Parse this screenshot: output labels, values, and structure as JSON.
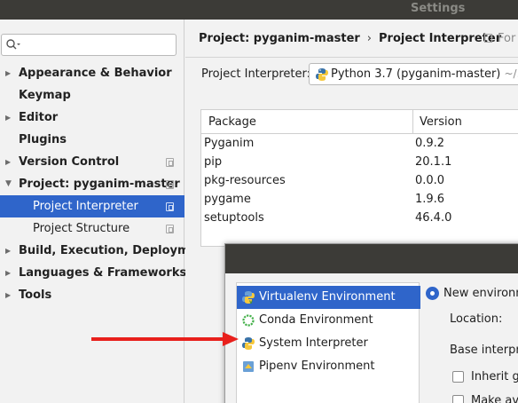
{
  "window": {
    "title": "Settings"
  },
  "search": {
    "placeholder": ""
  },
  "sidebar": {
    "items": [
      {
        "label": "Appearance & Behavior"
      },
      {
        "label": "Keymap"
      },
      {
        "label": "Editor"
      },
      {
        "label": "Plugins"
      },
      {
        "label": "Version Control"
      },
      {
        "label": "Project: pyganim-master"
      },
      {
        "label": "Project Interpreter"
      },
      {
        "label": "Project Structure"
      },
      {
        "label": "Build, Execution, Deployment"
      },
      {
        "label": "Languages & Frameworks"
      },
      {
        "label": "Tools"
      }
    ]
  },
  "breadcrumb": {
    "project": "Project: pyganim-master",
    "separator": "›",
    "page": "Project Interpreter",
    "for_current": "For c"
  },
  "interpreter": {
    "label": "Project Interpreter:",
    "name": "Python 3.7 (pyganim-master)",
    "path": "~/.virtua"
  },
  "packages": {
    "headers": [
      "Package",
      "Version"
    ],
    "rows": [
      {
        "name": "Pyganim",
        "version": "0.9.2"
      },
      {
        "name": "pip",
        "version": "20.1.1"
      },
      {
        "name": "pkg-resources",
        "version": "0.0.0"
      },
      {
        "name": "pygame",
        "version": "1.9.6"
      },
      {
        "name": "setuptools",
        "version": "46.4.0"
      }
    ]
  },
  "add_interpreter": {
    "environments": [
      {
        "label": "Virtualenv Environment",
        "icon": "virtualenv-icon"
      },
      {
        "label": "Conda Environment",
        "icon": "conda-icon"
      },
      {
        "label": "System Interpreter",
        "icon": "python-icon"
      },
      {
        "label": "Pipenv Environment",
        "icon": "pipenv-icon"
      }
    ],
    "new_env": "New environm",
    "location": "Location:",
    "base": "Base interpre",
    "inherit": "Inherit gl",
    "make": "Make ava"
  },
  "colors": {
    "selection": "#2f65ca",
    "arrow": "#e8201c"
  }
}
